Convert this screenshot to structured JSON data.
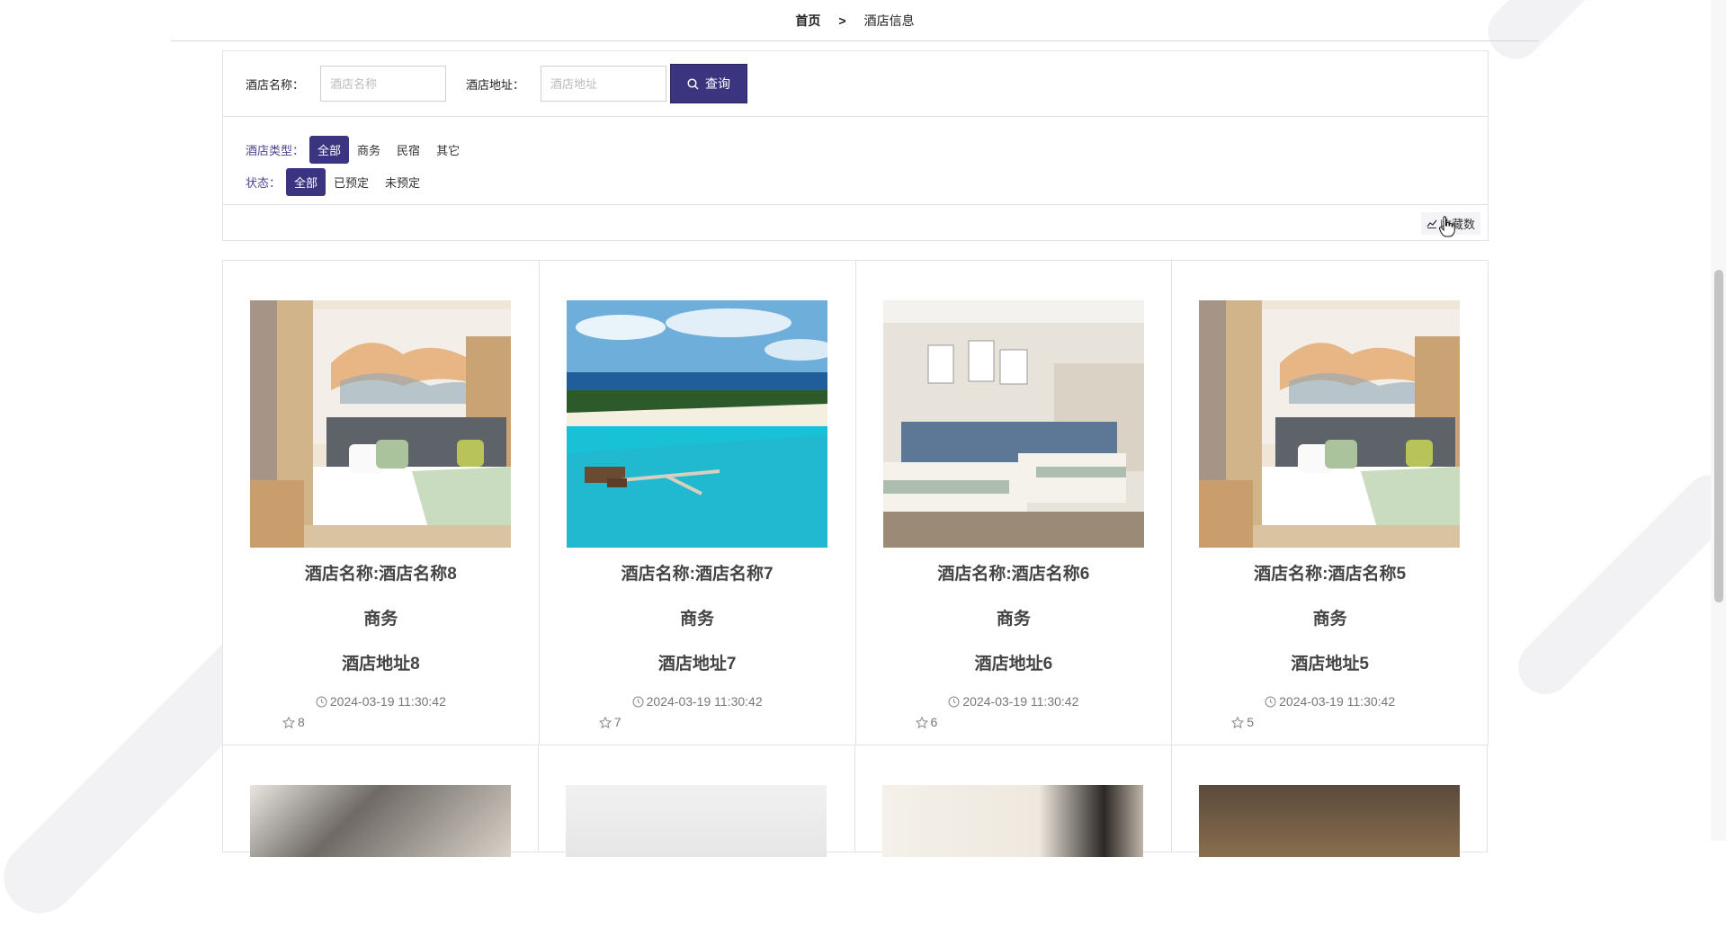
{
  "breadcrumb": {
    "home": "首页",
    "separator": ">",
    "current": "酒店信息"
  },
  "search": {
    "name_label": "酒店名称：",
    "name_placeholder": "酒店名称",
    "name_value": "",
    "address_label": "酒店地址：",
    "address_placeholder": "酒店地址",
    "address_value": "",
    "query_button": "查询"
  },
  "filters": {
    "type": {
      "title": "酒店类型：",
      "options": [
        "全部",
        "商务",
        "民宿",
        "其它"
      ],
      "selected": "全部"
    },
    "status": {
      "title": "状态：",
      "options": [
        "全部",
        "已预定",
        "未预定"
      ],
      "selected": "全部"
    }
  },
  "sort": {
    "label": "收藏数",
    "icon": "chart-icon"
  },
  "cards": [
    {
      "name": "酒店名称:酒店名称8",
      "type": "商务",
      "address": "酒店地址8",
      "time": "2024-03-19 11:30:42",
      "favorites": "8",
      "image": "hotel-room-mural"
    },
    {
      "name": "酒店名称:酒店名称7",
      "type": "商务",
      "address": "酒店地址7",
      "time": "2024-03-19 11:30:42",
      "favorites": "7",
      "image": "beach-resort"
    },
    {
      "name": "酒店名称:酒店名称6",
      "type": "商务",
      "address": "酒店地址6",
      "time": "2024-03-19 11:30:42",
      "favorites": "6",
      "image": "twin-bed-room"
    },
    {
      "name": "酒店名称:酒店名称5",
      "type": "商务",
      "address": "酒店地址5",
      "time": "2024-03-19 11:30:42",
      "favorites": "5",
      "image": "hotel-room-mural"
    }
  ],
  "colors": {
    "primary": "#3b3580",
    "border": "#e3e3e3"
  }
}
